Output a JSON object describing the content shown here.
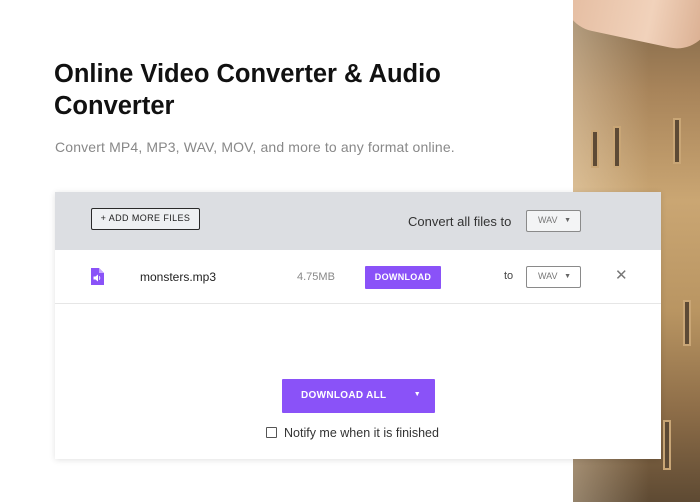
{
  "hero": {
    "title": "Online Video Converter & Audio Converter",
    "subtitle": "Convert MP4, MP3, WAV, MOV, and more to any format online."
  },
  "toolbar": {
    "add_files_label": "+ ADD MORE FILES",
    "convert_all_label": "Convert all files to",
    "convert_all_format": "WAV"
  },
  "files": [
    {
      "icon": "audio-file-icon",
      "name": "monsters.mp3",
      "size": "4.75MB",
      "download_label": "DOWNLOAD",
      "to_label": "to",
      "format": "WAV"
    }
  ],
  "footer": {
    "download_all_label": "DOWNLOAD ALL",
    "notify_label": "Notify me when it is finished",
    "notify_checked": false
  },
  "colors": {
    "accent": "#8a52f8",
    "header_bar": "#dcdee2",
    "title_text": "#111111",
    "subtitle_text": "#888888"
  },
  "icons": {
    "caret": "caret-down-icon",
    "close": "close-icon",
    "file": "audio-file-icon"
  }
}
